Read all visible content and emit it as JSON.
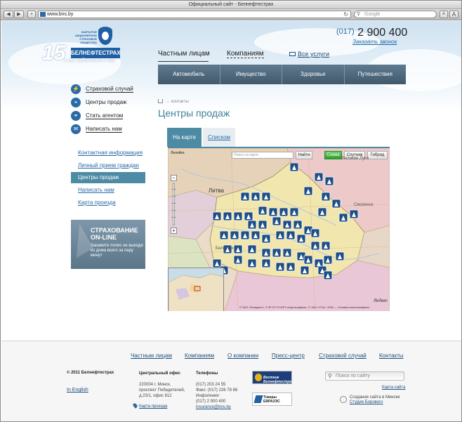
{
  "browser": {
    "window_title": "Официальный сайт - Белнефтестрах",
    "url": "www.bns.by",
    "search_placeholder": "Google",
    "back_label": "◀",
    "forward_label": "▶",
    "add_label": "+",
    "font_small_label": "A",
    "font_large_label": "A"
  },
  "header": {
    "logo_text": "БЕЛНЕФТЕСТРАХ",
    "logo_small": "Закрытое акционерное страховое общество",
    "anniversary": "15",
    "slogan": "и мы заботимся о вас",
    "phone_code": "(017)",
    "phone_number": "2 900 400",
    "callback": "Заказать звонок"
  },
  "topnav": {
    "items": [
      {
        "label": "Частным лицам"
      },
      {
        "label": "Компаниям"
      }
    ],
    "all_services": "Все услуги"
  },
  "menubar": {
    "items": [
      {
        "label": "Автомобиль"
      },
      {
        "label": "Имущество"
      },
      {
        "label": "Здоровье"
      },
      {
        "label": "Путешествия"
      }
    ]
  },
  "side_links": [
    {
      "label": "Страховой случай",
      "icon": "lightning-icon"
    },
    {
      "label": "Центры продаж",
      "icon": "location-icon"
    },
    {
      "label": "Стать агентом",
      "icon": "handshake-icon"
    },
    {
      "label": "Написать нам",
      "icon": "envelope-icon"
    }
  ],
  "subnav": [
    {
      "label": "Контактная информация",
      "active": false
    },
    {
      "label": "Личный прием граждан",
      "active": false
    },
    {
      "label": "Центры продаж",
      "active": true
    },
    {
      "label": "Написать нам",
      "active": false
    },
    {
      "label": "Карта проезда",
      "active": false
    }
  ],
  "promo": {
    "title_line1": "СТРАХОВАНИЕ",
    "title_line2": "ON-LINE",
    "text": "Закажите полис не выходя из дома всего за пару минут"
  },
  "breadcrumb": {
    "separator": "→",
    "current": "контакты"
  },
  "page_title": "Центры продаж",
  "tabs": [
    {
      "label": "На карте",
      "active": true
    },
    {
      "label": "Списком",
      "active": false
    }
  ],
  "map": {
    "search_placeholder": "Поиск на карте",
    "find_button": "Найти",
    "modes": [
      {
        "label": "Схема",
        "active": true
      },
      {
        "label": "Спутник",
        "active": false
      },
      {
        "label": "Гибрид",
        "active": false
      }
    ],
    "ruler_label": "Линейка",
    "labels": [
      "Литва",
      "Смоленск",
      "Белосток",
      "Великие Луки"
    ],
    "copyright": "© ЗАО «Резидент», © ФГУП «ГНПП «Картография», © ЗАО «ТГА», 2009 — Условия использования",
    "provider": "Яндекс"
  },
  "footer": {
    "nav": [
      {
        "label": "Частным лицам"
      },
      {
        "label": "Компаниям"
      },
      {
        "label": "О компании"
      },
      {
        "label": "Пресс-центр"
      },
      {
        "label": "Страховой случай"
      },
      {
        "label": "Контакты"
      }
    ],
    "copyright": "© 2011 Белнефтестрах",
    "in_english": "In English",
    "office_title": "Центральный офис",
    "office_lines": [
      "220004 г. Минск,",
      "проспект Победителей,",
      "д.23/1, офис 812"
    ],
    "map_link": "Карта проезда",
    "phones_title": "Телефоны",
    "phones_lines": [
      "(017) 203 24 55",
      "Факс: (017) 226 78 86",
      "Инфолиния:",
      "(017) 2 900 400"
    ],
    "email": "insurance@bns.by",
    "badge1": "Вестник Белнефтестраха",
    "badge2_line1": "Товары",
    "badge2_line2": "ЕВРАЗЭС",
    "search_placeholder": "Поиск по сайту",
    "sitemap": "Карта сайта",
    "creator_line1": "Создание сайта в Минске",
    "creator_link": "Студия Борового"
  }
}
